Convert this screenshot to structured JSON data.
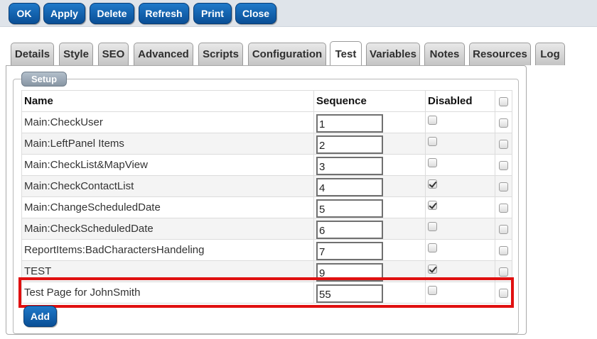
{
  "toolbar": {
    "buttons": [
      {
        "label": "OK"
      },
      {
        "label": "Apply"
      },
      {
        "label": "Delete"
      },
      {
        "label": "Refresh"
      },
      {
        "label": "Print"
      },
      {
        "label": "Close"
      }
    ]
  },
  "tabs": [
    {
      "label": "Details",
      "active": false
    },
    {
      "label": "Style",
      "active": false
    },
    {
      "label": "SEO",
      "active": false
    },
    {
      "label": "Advanced",
      "active": false
    },
    {
      "label": "Scripts",
      "active": false
    },
    {
      "label": "Configuration",
      "active": false
    },
    {
      "label": "Test",
      "active": true
    },
    {
      "label": "Variables",
      "active": false
    },
    {
      "label": "Notes",
      "active": false
    },
    {
      "label": "Resources",
      "active": false
    },
    {
      "label": "Log",
      "active": false
    }
  ],
  "setup": {
    "legend": "Setup",
    "columns": {
      "name": "Name",
      "sequence": "Sequence",
      "disabled": "Disabled"
    },
    "rows": [
      {
        "name": "Main:CheckUser",
        "sequence": "1",
        "disabled": false,
        "selected": false
      },
      {
        "name": "Main:LeftPanel Items",
        "sequence": "2",
        "disabled": false,
        "selected": false
      },
      {
        "name": "Main:CheckList&MapView",
        "sequence": "3",
        "disabled": false,
        "selected": false
      },
      {
        "name": "Main:CheckContactList",
        "sequence": "4",
        "disabled": true,
        "selected": false
      },
      {
        "name": "Main:ChangeScheduledDate",
        "sequence": "5",
        "disabled": true,
        "selected": false
      },
      {
        "name": "Main:CheckScheduledDate",
        "sequence": "6",
        "disabled": false,
        "selected": false
      },
      {
        "name": "ReportItems:BadCharactersHandeling",
        "sequence": "7",
        "disabled": false,
        "selected": false
      },
      {
        "name": "TEST",
        "sequence": "9",
        "disabled": true,
        "selected": false
      },
      {
        "name": "Test Page for JohnSmith",
        "sequence": "55",
        "disabled": false,
        "selected": false
      }
    ],
    "add_label": "Add"
  },
  "colors": {
    "button_blue": "#0a4f96",
    "highlight_red": "#e01010"
  }
}
